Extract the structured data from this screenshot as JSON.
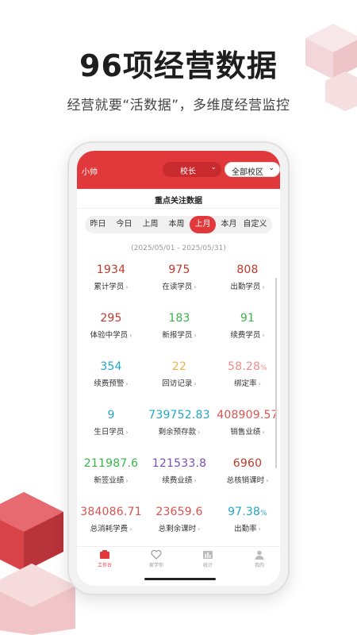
{
  "headline": "96项经营数据",
  "subline": "经营就要“活数据”，多维度经营监控",
  "app": {
    "user": "小帅",
    "role_label": "校长",
    "campus_label": "全部校区",
    "section_title": "重点关注数据",
    "periods": [
      {
        "label": "昨日",
        "active": false
      },
      {
        "label": "今日",
        "active": false
      },
      {
        "label": "上周",
        "active": false
      },
      {
        "label": "本周",
        "active": false
      },
      {
        "label": "上月",
        "active": true
      },
      {
        "label": "本月",
        "active": false
      },
      {
        "label": "自定义",
        "active": false
      }
    ],
    "date_range": "(2025/05/01 - 2025/05/31)",
    "metrics": [
      {
        "value": "1934",
        "label": "累计学员",
        "color": "#c0392b"
      },
      {
        "value": "975",
        "label": "在读学员",
        "color": "#c0392b"
      },
      {
        "value": "808",
        "label": "出勤学员",
        "color": "#c0392b"
      },
      {
        "value": "295",
        "label": "体验中学员",
        "color": "#c0392b"
      },
      {
        "value": "183",
        "label": "新报学员",
        "color": "#3ab54a"
      },
      {
        "value": "91",
        "label": "续费学员",
        "color": "#3ab54a"
      },
      {
        "value": "354",
        "label": "续费预警",
        "color": "#22a7c9"
      },
      {
        "value": "22",
        "label": "回访记录",
        "color": "#f0b24a"
      },
      {
        "value": "58.28",
        "unit": "%",
        "label": "绑定率",
        "color": "#ef8c8c"
      },
      {
        "value": "9",
        "label": "生日学员",
        "color": "#22a7c9"
      },
      {
        "value": "739752.83",
        "label": "剩余预存款",
        "color": "#22a7c9"
      },
      {
        "value": "408909.57",
        "label": "销售业绩",
        "color": "#d9534f"
      },
      {
        "value": "211987.6",
        "label": "新签业绩",
        "color": "#3ab54a"
      },
      {
        "value": "121533.8",
        "label": "续费业绩",
        "color": "#7b4fb5"
      },
      {
        "value": "6960",
        "label": "总核销课时",
        "color": "#c0392b"
      },
      {
        "value": "384086.71",
        "label": "总消耗学费",
        "color": "#d9534f"
      },
      {
        "value": "23659.6",
        "label": "总剩余课时",
        "color": "#d9534f"
      },
      {
        "value": "97.38",
        "unit": "%",
        "label": "出勤率",
        "color": "#22a7c9"
      }
    ],
    "tabs": [
      {
        "label": "工作台",
        "icon": "workbench-icon",
        "active": true
      },
      {
        "label": "家学你",
        "icon": "heart-icon",
        "active": false
      },
      {
        "label": "统计",
        "icon": "bar-chart-icon",
        "active": false
      },
      {
        "label": "我的",
        "icon": "user-icon",
        "active": false
      }
    ]
  }
}
